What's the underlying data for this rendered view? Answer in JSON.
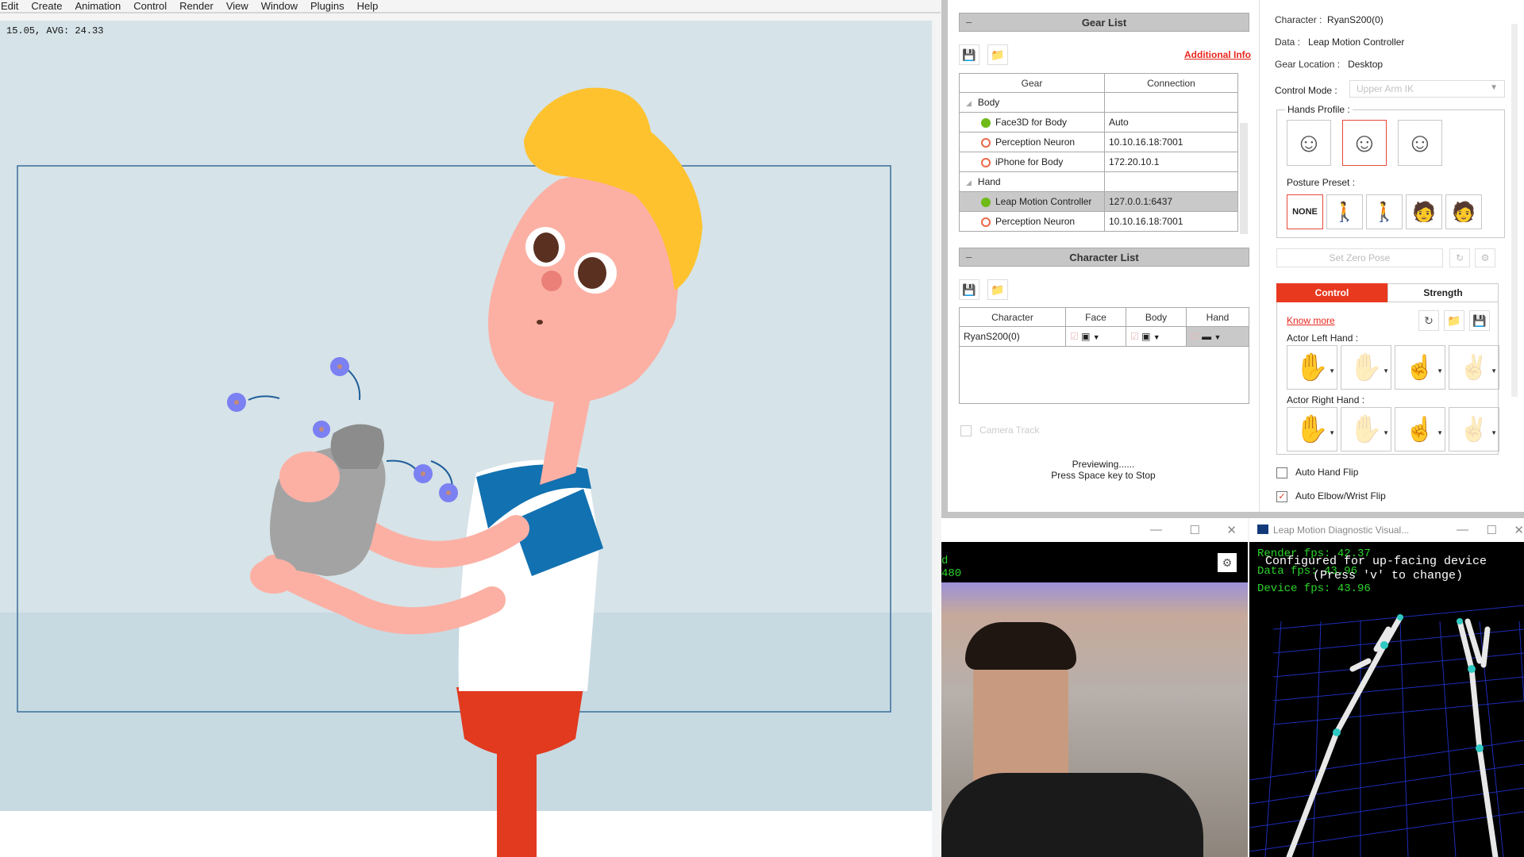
{
  "menu": [
    "Edit",
    "Create",
    "Animation",
    "Control",
    "Render",
    "View",
    "Window",
    "Plugins",
    "Help"
  ],
  "viewport": {
    "fps_readout": "15.05, AVG: 24.33"
  },
  "gear_list": {
    "title": "Gear List",
    "collapse_glyph": "–",
    "additional_info": "Additional Info",
    "columns": [
      "Gear",
      "Connection"
    ],
    "groups": [
      {
        "name": "Body",
        "items": [
          {
            "name": "Face3D for Body",
            "connection": "Auto",
            "status": "connected"
          },
          {
            "name": "Perception Neuron",
            "connection": "10.10.16.18:7001",
            "status": "disconnected"
          },
          {
            "name": "iPhone for Body",
            "connection": "172.20.10.1",
            "status": "disconnected"
          }
        ]
      },
      {
        "name": "Hand",
        "items": [
          {
            "name": "Leap Motion Controller",
            "connection": "127.0.0.1:6437",
            "status": "connected",
            "selected": true
          },
          {
            "name": "Perception Neuron",
            "connection": "10.10.16.18:7001",
            "status": "disconnected"
          }
        ]
      }
    ],
    "status_colors": {
      "connected": "#6fba16",
      "disconnected": "#ea6948"
    }
  },
  "character_list": {
    "title": "Character List",
    "collapse_glyph": "–",
    "columns": [
      "Character",
      "Face",
      "Body",
      "Hand"
    ],
    "rows": [
      {
        "character": "RyanS200(0)",
        "face_device": "webcam-icon",
        "body_device": "webcam-icon",
        "hand_device": "leap-motion-icon"
      }
    ],
    "camera_track": "Camera Track",
    "preview_line1": "Previewing......",
    "preview_line2": "Press Space key to Stop"
  },
  "character_props": {
    "character_label": "Character :",
    "character_value": "RyanS200(0)",
    "data_label": "Data :",
    "data_value": "Leap Motion Controller",
    "gear_location_label": "Gear Location :",
    "gear_location_value": "Desktop",
    "control_mode_label": "Control Mode :",
    "control_mode_value": "Upper Arm IK",
    "hands_profile_label": "Hands Profile :",
    "hands_profile_selected": 1,
    "posture_preset_label": "Posture Preset :",
    "posture_none": "NONE",
    "set_zero_pose": "Set Zero Pose",
    "tabs": [
      "Control",
      "Strength"
    ],
    "active_tab": "Control",
    "know_more": "Know more",
    "actor_left_hand": "Actor Left Hand :",
    "actor_right_hand": "Actor Right Hand :",
    "auto_hand_flip": "Auto Hand Flip",
    "auto_elbow_wrist_flip": "Auto Elbow/Wrist Flip",
    "auto_hand_flip_checked": false,
    "auto_elbow_wrist_flip_checked": true,
    "accent": "#e8391f"
  },
  "webcam_window": {
    "overlay_line1": "d",
    "overlay_line2": "480"
  },
  "leap_window": {
    "title": "Leap Motion Diagnostic Visual...",
    "render_fps": "Render fps: 42.37",
    "data_fps": "Data fps: 43.96",
    "device_fps": "Device fps: 43.96",
    "configured": "Configured for up-facing device",
    "press_v": "(Press 'v' to change)"
  },
  "window_controls": {
    "minimize": "—",
    "maximize": "☐",
    "close": "✕"
  }
}
